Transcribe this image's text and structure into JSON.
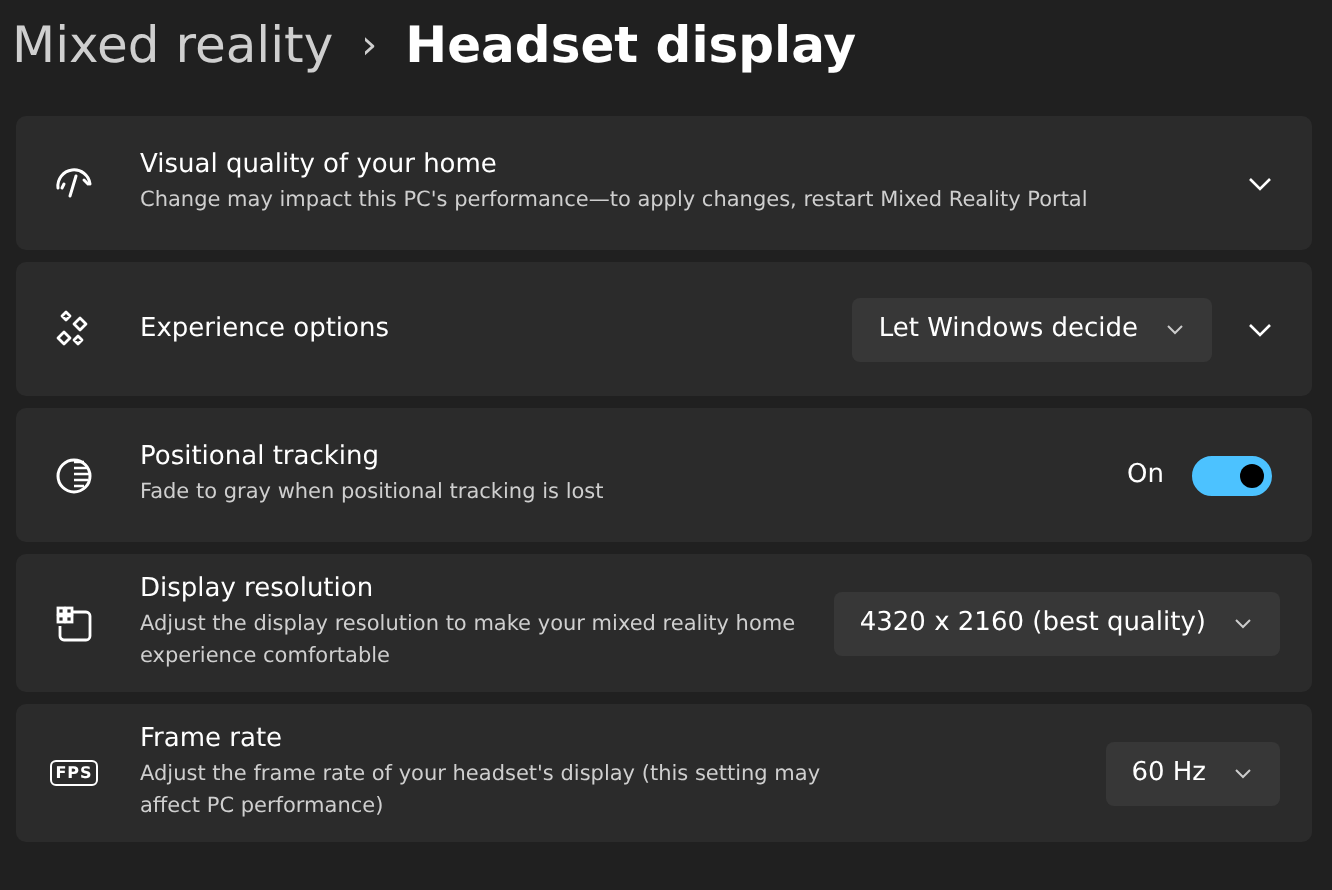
{
  "breadcrumb": {
    "parent": "Mixed reality",
    "separator": "›",
    "current": "Headset display"
  },
  "settings": [
    {
      "kind": "expander",
      "title": "Visual quality of your home",
      "description": "Change may impact this PC's performance—to apply changes, restart Mixed Reality Portal",
      "expanded": false
    },
    {
      "kind": "combo_expander",
      "title": "Experience options",
      "value": "Let Windows decide",
      "expanded": false
    },
    {
      "kind": "toggle",
      "title": "Positional tracking",
      "description": "Fade to gray when positional tracking is lost",
      "state_label": "On",
      "on": true
    },
    {
      "kind": "combo",
      "title": "Display resolution",
      "description": "Adjust the display resolution to make your mixed reality home experience comfortable",
      "value": "4320 x 2160 (best quality)"
    },
    {
      "kind": "combo",
      "icon_text": "FPS",
      "title": "Frame rate",
      "description": "Adjust the frame rate of your headset's display (this setting may affect PC performance)",
      "value": "60 Hz"
    }
  ]
}
